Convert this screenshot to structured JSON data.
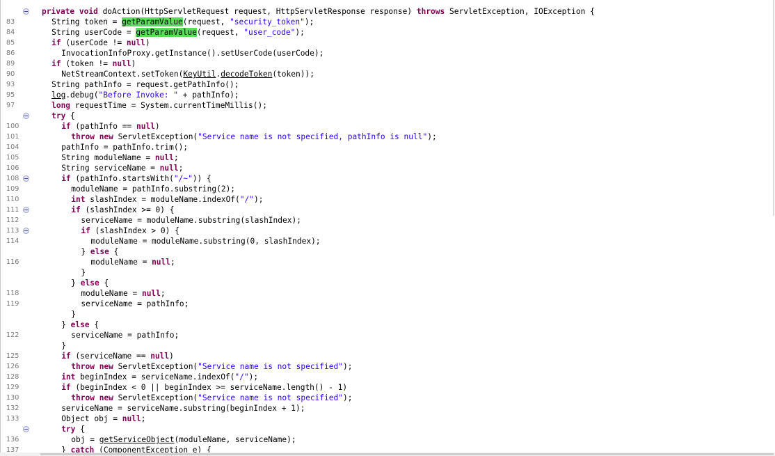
{
  "editor": {
    "lines": [
      {
        "ln": "",
        "fold": true,
        "indent": 0,
        "t": [
          [
            "kw",
            "private void "
          ],
          [
            "",
            "doAction(HttpServletRequest request, HttpServletResponse response) "
          ],
          [
            "kw",
            "throws "
          ],
          [
            "",
            "ServletException, IOException {"
          ]
        ]
      },
      {
        "ln": "83",
        "indent": 1,
        "t": [
          [
            "",
            "String token = "
          ],
          [
            "hl",
            "getParamValue"
          ],
          [
            "",
            "(request, "
          ],
          [
            "str",
            "\"security_token\""
          ],
          [
            "",
            ");"
          ]
        ]
      },
      {
        "ln": "84",
        "indent": 1,
        "t": [
          [
            "",
            "String userCode = "
          ],
          [
            "hl",
            "getParamValue"
          ],
          [
            "",
            "(request, "
          ],
          [
            "str",
            "\"user_code\""
          ],
          [
            "",
            ");"
          ]
        ]
      },
      {
        "ln": "85",
        "indent": 1,
        "t": [
          [
            "kw",
            "if "
          ],
          [
            "",
            "(userCode != "
          ],
          [
            "kw",
            "null"
          ],
          [
            "",
            ")"
          ]
        ]
      },
      {
        "ln": "86",
        "indent": 2,
        "t": [
          [
            "",
            "InvocationInfoProxy.getInstance().setUserCode(userCode);"
          ]
        ]
      },
      {
        "ln": "89",
        "indent": 1,
        "t": [
          [
            "kw",
            "if "
          ],
          [
            "",
            "(token != "
          ],
          [
            "kw",
            "null"
          ],
          [
            "",
            ")"
          ]
        ]
      },
      {
        "ln": "90",
        "indent": 2,
        "t": [
          [
            "",
            "NetStreamContext.setToken("
          ],
          [
            "ul",
            "KeyUtil"
          ],
          [
            "",
            "."
          ],
          [
            "ul",
            "decodeToken"
          ],
          [
            "",
            "(token));"
          ]
        ]
      },
      {
        "ln": "93",
        "indent": 1,
        "t": [
          [
            "",
            "String pathInfo = request.getPathInfo();"
          ]
        ]
      },
      {
        "ln": "95",
        "indent": 1,
        "t": [
          [
            "ul",
            "log"
          ],
          [
            "",
            ".debug("
          ],
          [
            "str",
            "\"Before Invoke: \""
          ],
          [
            "",
            " + pathInfo);"
          ]
        ]
      },
      {
        "ln": "97",
        "indent": 1,
        "t": [
          [
            "kw",
            "long "
          ],
          [
            "",
            "requestTime = System.currentTimeMillis();"
          ]
        ]
      },
      {
        "ln": "",
        "fold": true,
        "indent": 1,
        "t": [
          [
            "kw",
            "try "
          ],
          [
            "",
            "{"
          ]
        ]
      },
      {
        "ln": "100",
        "indent": 2,
        "t": [
          [
            "kw",
            "if "
          ],
          [
            "",
            "(pathInfo == "
          ],
          [
            "kw",
            "null"
          ],
          [
            "",
            ")"
          ]
        ]
      },
      {
        "ln": "101",
        "indent": 3,
        "t": [
          [
            "kw",
            "throw new "
          ],
          [
            "",
            "ServletException("
          ],
          [
            "str",
            "\"Service name is not specified, pathInfo is null\""
          ],
          [
            "",
            ");"
          ]
        ]
      },
      {
        "ln": "104",
        "indent": 2,
        "t": [
          [
            "",
            "pathInfo = pathInfo.trim();"
          ]
        ]
      },
      {
        "ln": "105",
        "indent": 2,
        "t": [
          [
            "",
            "String moduleName = "
          ],
          [
            "kw",
            "null"
          ],
          [
            "",
            ";"
          ]
        ]
      },
      {
        "ln": "106",
        "indent": 2,
        "t": [
          [
            "",
            "String serviceName = "
          ],
          [
            "kw",
            "null"
          ],
          [
            "",
            ";"
          ]
        ]
      },
      {
        "ln": "108",
        "fold": true,
        "indent": 2,
        "t": [
          [
            "kw",
            "if "
          ],
          [
            "",
            "(pathInfo.startsWith("
          ],
          [
            "str",
            "\"/~\""
          ],
          [
            "",
            ")) {"
          ]
        ]
      },
      {
        "ln": "109",
        "indent": 3,
        "t": [
          [
            "",
            "moduleName = pathInfo.substring(2);"
          ]
        ]
      },
      {
        "ln": "110",
        "indent": 3,
        "t": [
          [
            "kw",
            "int "
          ],
          [
            "",
            "slashIndex = moduleName.indexOf("
          ],
          [
            "str",
            "\"/\""
          ],
          [
            "",
            ");"
          ]
        ]
      },
      {
        "ln": "111",
        "fold": true,
        "indent": 3,
        "t": [
          [
            "kw",
            "if "
          ],
          [
            "",
            "(slashIndex >= 0) {"
          ]
        ]
      },
      {
        "ln": "112",
        "indent": 4,
        "t": [
          [
            "",
            "serviceName = moduleName.substring(slashIndex);"
          ]
        ]
      },
      {
        "ln": "113",
        "fold": true,
        "indent": 4,
        "t": [
          [
            "kw",
            "if "
          ],
          [
            "",
            "(slashIndex > 0) {"
          ]
        ]
      },
      {
        "ln": "114",
        "indent": 5,
        "t": [
          [
            "",
            "moduleName = moduleName.substring(0, slashIndex);"
          ]
        ]
      },
      {
        "ln": "",
        "indent": 4,
        "t": [
          [
            "",
            "} "
          ],
          [
            "kw",
            "else "
          ],
          [
            "",
            "{"
          ]
        ]
      },
      {
        "ln": "116",
        "indent": 5,
        "t": [
          [
            "",
            "moduleName = "
          ],
          [
            "kw",
            "null"
          ],
          [
            "",
            ";"
          ]
        ]
      },
      {
        "ln": "",
        "indent": 4,
        "t": [
          [
            "",
            "}"
          ]
        ]
      },
      {
        "ln": "",
        "indent": 3,
        "t": [
          [
            "",
            "} "
          ],
          [
            "kw",
            "else "
          ],
          [
            "",
            "{"
          ]
        ]
      },
      {
        "ln": "118",
        "indent": 4,
        "t": [
          [
            "",
            "moduleName = "
          ],
          [
            "kw",
            "null"
          ],
          [
            "",
            ";"
          ]
        ]
      },
      {
        "ln": "119",
        "indent": 4,
        "t": [
          [
            "",
            "serviceName = pathInfo;"
          ]
        ]
      },
      {
        "ln": "",
        "indent": 3,
        "t": [
          [
            "",
            "}"
          ]
        ]
      },
      {
        "ln": "",
        "indent": 2,
        "t": [
          [
            "",
            "} "
          ],
          [
            "kw",
            "else "
          ],
          [
            "",
            "{"
          ]
        ]
      },
      {
        "ln": "122",
        "indent": 3,
        "t": [
          [
            "",
            "serviceName = pathInfo;"
          ]
        ]
      },
      {
        "ln": "",
        "indent": 2,
        "t": [
          [
            "",
            "}"
          ]
        ]
      },
      {
        "ln": "125",
        "indent": 2,
        "t": [
          [
            "kw",
            "if "
          ],
          [
            "",
            "(serviceName == "
          ],
          [
            "kw",
            "null"
          ],
          [
            "",
            ")"
          ]
        ]
      },
      {
        "ln": "126",
        "indent": 3,
        "t": [
          [
            "kw",
            "throw new "
          ],
          [
            "",
            "ServletException("
          ],
          [
            "str",
            "\"Service name is not specified\""
          ],
          [
            "",
            ");"
          ]
        ]
      },
      {
        "ln": "128",
        "indent": 2,
        "t": [
          [
            "kw",
            "int "
          ],
          [
            "",
            "beginIndex = serviceName.indexOf("
          ],
          [
            "str",
            "\"/\""
          ],
          [
            "",
            ");"
          ]
        ]
      },
      {
        "ln": "129",
        "indent": 2,
        "t": [
          [
            "kw",
            "if "
          ],
          [
            "",
            "(beginIndex < 0 || beginIndex >= serviceName.length() - 1)"
          ]
        ]
      },
      {
        "ln": "130",
        "indent": 3,
        "t": [
          [
            "kw",
            "throw new "
          ],
          [
            "",
            "ServletException("
          ],
          [
            "str",
            "\"Service name is not specified\""
          ],
          [
            "",
            ");"
          ]
        ]
      },
      {
        "ln": "132",
        "indent": 2,
        "t": [
          [
            "",
            "serviceName = serviceName.substring(beginIndex + 1);"
          ]
        ]
      },
      {
        "ln": "133",
        "indent": 2,
        "t": [
          [
            "",
            "Object obj = "
          ],
          [
            "kw",
            "null"
          ],
          [
            "",
            ";"
          ]
        ]
      },
      {
        "ln": "",
        "fold": true,
        "indent": 2,
        "t": [
          [
            "kw",
            "try "
          ],
          [
            "",
            "{"
          ]
        ]
      },
      {
        "ln": "136",
        "indent": 3,
        "t": [
          [
            "",
            "obj = "
          ],
          [
            "ul",
            "getServiceObject"
          ],
          [
            "",
            "(moduleName, serviceName);"
          ]
        ]
      },
      {
        "ln": "137",
        "indent": 2,
        "t": [
          [
            "",
            "} "
          ],
          [
            "kw",
            "catch "
          ],
          [
            "",
            "(ComponentException e) {"
          ]
        ]
      }
    ]
  }
}
